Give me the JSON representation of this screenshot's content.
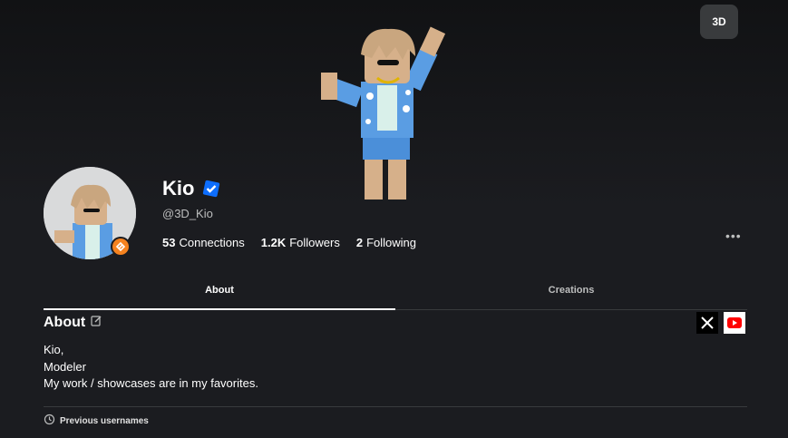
{
  "banner": {
    "view_toggle_label": "3D"
  },
  "profile": {
    "display_name": "Kio",
    "username": "@3D_Kio",
    "stats": [
      {
        "value": "53",
        "label": "Connections"
      },
      {
        "value": "1.2K",
        "label": "Followers"
      },
      {
        "value": "2",
        "label": "Following"
      }
    ],
    "more_label": "•••"
  },
  "tabs": [
    {
      "label": "About",
      "active": true
    },
    {
      "label": "Creations",
      "active": false
    }
  ],
  "about": {
    "title": "About",
    "lines": [
      "Kio,",
      "Modeler",
      "My work / showcases are in my favorites."
    ]
  },
  "footer": {
    "previous_usernames_label": "Previous usernames"
  },
  "colors": {
    "background": "#1b1c20",
    "verified": "#0d6efd",
    "premium": "#f5821f",
    "youtube": "#ff0000"
  },
  "icons": [
    "verified-badge-icon",
    "premium-badge-icon",
    "edit-icon",
    "x-social-icon",
    "youtube-icon",
    "history-icon",
    "more-icon"
  ]
}
